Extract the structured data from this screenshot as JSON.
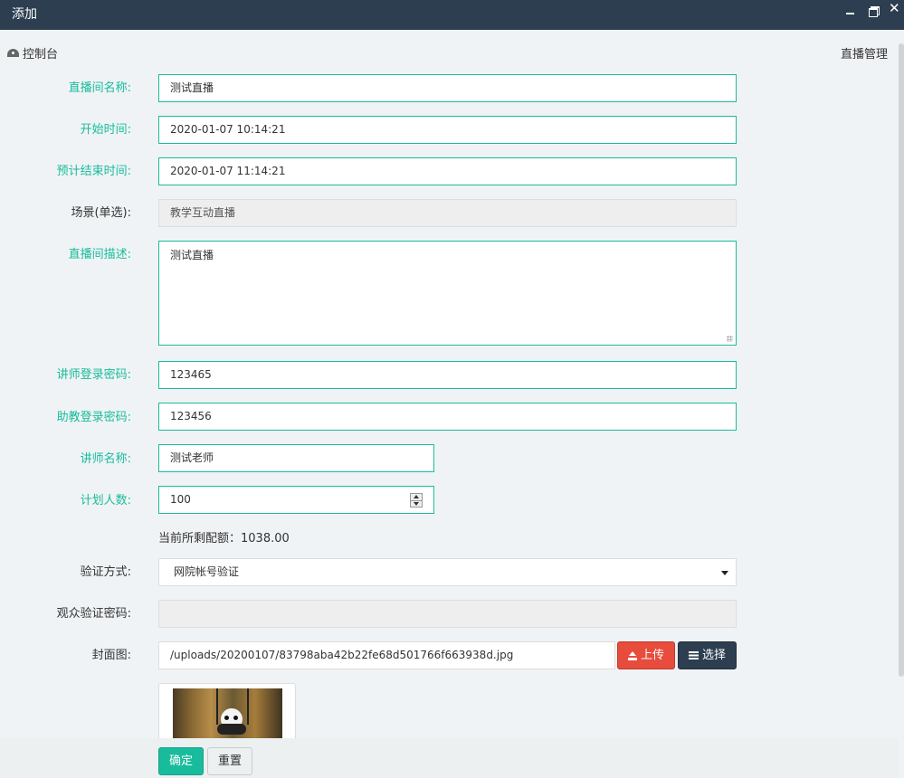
{
  "window": {
    "title": "添加"
  },
  "nav": {
    "dashboard": "控制台",
    "section": "直播管理"
  },
  "form": {
    "name": {
      "label": "直播间名称:",
      "value": "测试直播"
    },
    "start_time": {
      "label": "开始时间:",
      "value": "2020-01-07 10:14:21"
    },
    "end_time": {
      "label": "预计结束时间:",
      "value": "2020-01-07 11:14:21"
    },
    "scene": {
      "label": "场景(单选):",
      "value": "教学互动直播"
    },
    "description": {
      "label": "直播间描述:",
      "value": "测试直播"
    },
    "teacher_password": {
      "label": "讲师登录密码:",
      "value": "123465"
    },
    "assistant_password": {
      "label": "助教登录密码:",
      "value": "123456"
    },
    "teacher_name": {
      "label": "讲师名称:",
      "value": "测试老师"
    },
    "planned_count": {
      "label": "计划人数:",
      "value": "100"
    },
    "quota_text": "当前所剩配额：1038.00",
    "auth_method": {
      "label": "验证方式:",
      "value": "网院帐号验证"
    },
    "audience_password": {
      "label": "观众验证密码:",
      "value": ""
    },
    "cover": {
      "label": "封面图:",
      "value": "/uploads/20200107/83798aba42b22fe68d501766f663938d.jpg",
      "upload_label": "上传",
      "choose_label": "选择"
    }
  },
  "footer": {
    "ok_label": "确定",
    "reset_label": "重置"
  },
  "colors": {
    "accent": "#18bc9c",
    "danger": "#e74c3c",
    "dark": "#2c3e50"
  }
}
